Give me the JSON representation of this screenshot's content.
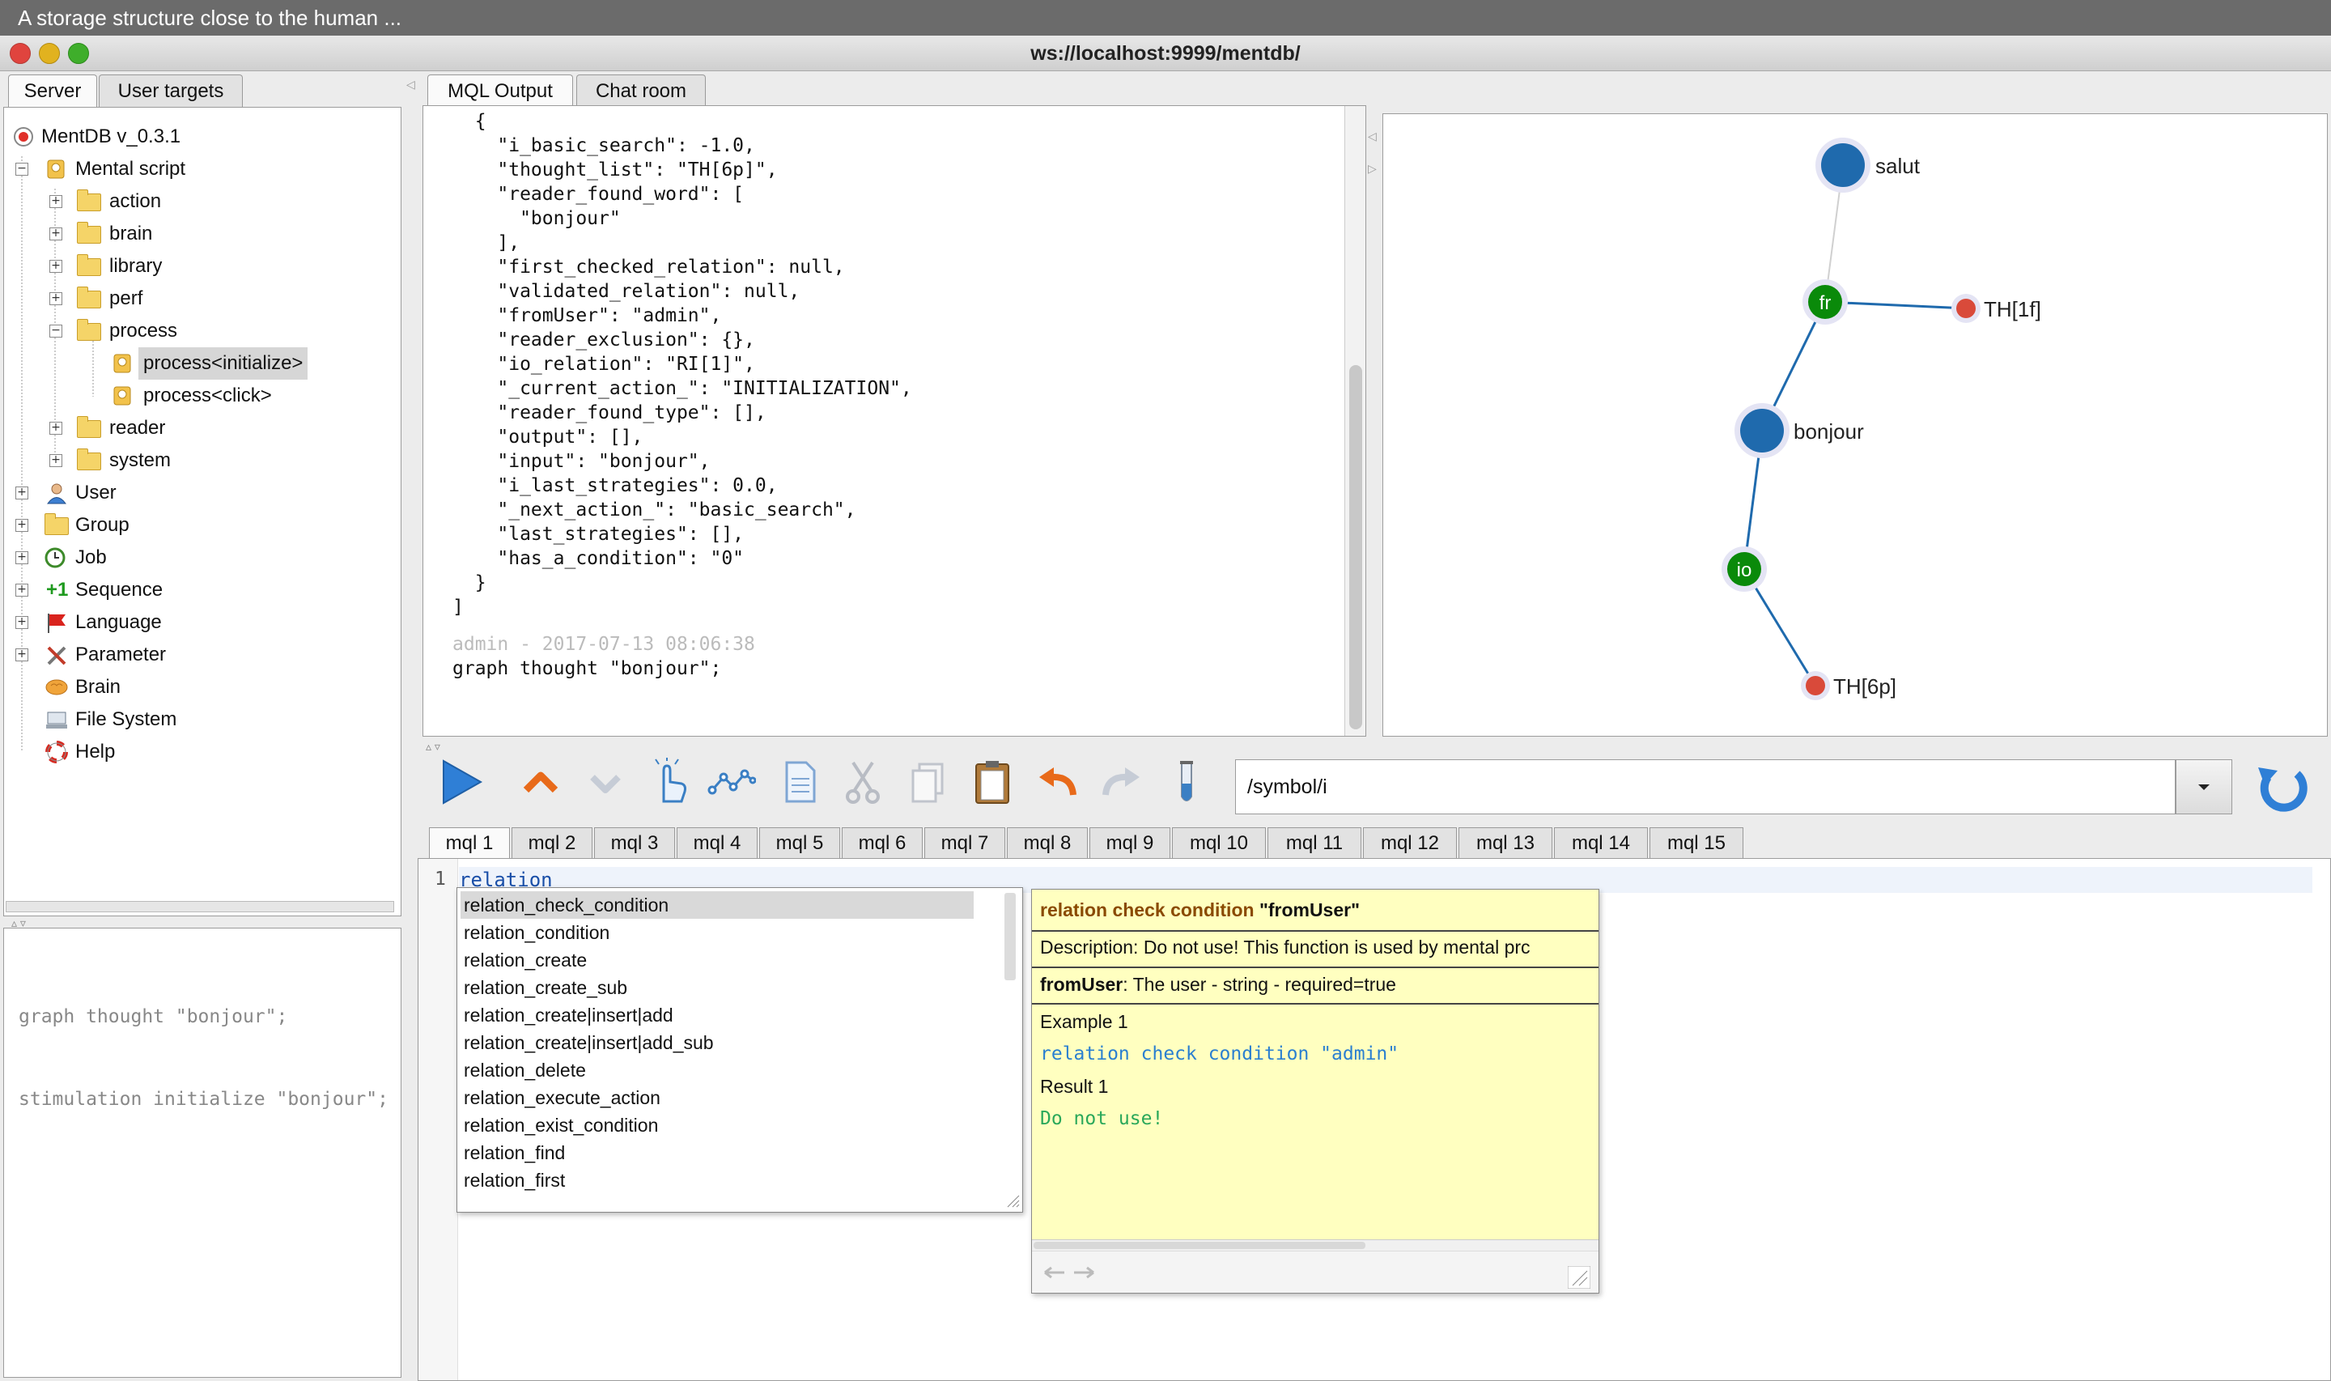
{
  "app": {
    "top_title": "A storage structure close to the human ...",
    "window_title": "ws://localhost:9999/mentdb/"
  },
  "left_tabs": [
    {
      "label": "Server",
      "active": true
    },
    {
      "label": "User targets",
      "active": false
    }
  ],
  "tree": {
    "root": "MentDB v_0.3.1",
    "mental_script": "Mental script",
    "folders": [
      "action",
      "brain",
      "library",
      "perf",
      "process"
    ],
    "process_children": [
      "process<initialize>",
      "process<click>"
    ],
    "folders2": [
      "reader",
      "system"
    ],
    "top_level": [
      "User",
      "Group",
      "Job",
      "Sequence",
      "Language",
      "Parameter",
      "Brain",
      "File System",
      "Help"
    ]
  },
  "script_box": {
    "lines": [
      "graph thought \"bonjour\";",
      "stimulation initialize \"bonjour\";"
    ]
  },
  "output_tabs": [
    {
      "label": "MQL Output",
      "active": true
    },
    {
      "label": "Chat room",
      "active": false
    }
  ],
  "output": {
    "json_lines": [
      "  {",
      "    \"i_basic_search\": -1.0,",
      "    \"thought_list\": \"TH[6p]\",",
      "    \"reader_found_word\": [",
      "      \"bonjour\"",
      "    ],",
      "    \"first_checked_relation\": null,",
      "    \"validated_relation\": null,",
      "    \"fromUser\": \"admin\",",
      "    \"reader_exclusion\": {},",
      "    \"io_relation\": \"RI[1]\",",
      "    \"_current_action_\": \"INITIALIZATION\",",
      "    \"reader_found_type\": [],",
      "    \"output\": [],",
      "    \"input\": \"bonjour\",",
      "    \"i_last_strategies\": 0.0,",
      "    \"_next_action_\": \"basic_search\",",
      "    \"last_strategies\": [],",
      "    \"has_a_condition\": \"0\"",
      "  }",
      "]"
    ],
    "meta": "admin - 2017-07-13 08:06:38",
    "command": "graph thought \"bonjour\";"
  },
  "graph": {
    "nodes": [
      {
        "id": "salut",
        "label": "salut"
      },
      {
        "id": "fr",
        "label": "fr"
      },
      {
        "id": "th1f",
        "label": "TH[1f]"
      },
      {
        "id": "bonjour",
        "label": "bonjour"
      },
      {
        "id": "io",
        "label": "io"
      },
      {
        "id": "th6p",
        "label": "TH[6p]"
      }
    ],
    "colors": {
      "blue": "#1f6aad",
      "green": "#0a8a0a",
      "red": "#d94a3a",
      "edge": "#1f6aad"
    }
  },
  "toolbar": {
    "icons": [
      "play-icon",
      "arrow-up-icon",
      "arrow-down-icon",
      "hand-pointer-icon",
      "graph-icon",
      "document-icon",
      "scissors-icon",
      "copy-icon",
      "paste-icon",
      "undo-icon",
      "redo-icon",
      "test-tube-icon"
    ],
    "path_value": "/symbol/i"
  },
  "mql_tabs": [
    "mql 1",
    "mql 2",
    "mql 3",
    "mql 4",
    "mql 5",
    "mql 6",
    "mql 7",
    "mql 8",
    "mql 9",
    "mql 10",
    "mql 11",
    "mql 12",
    "mql 13",
    "mql 14",
    "mql 15"
  ],
  "editor": {
    "line_number": "1",
    "text": "relation"
  },
  "autocomplete": {
    "items": [
      "relation_check_condition",
      "relation_condition",
      "relation_create",
      "relation_create_sub",
      "relation_create|insert|add",
      "relation_create|insert|add_sub",
      "relation_delete",
      "relation_execute_action",
      "relation_exist_condition",
      "relation_find",
      "relation_first"
    ],
    "selected_index": 0
  },
  "help": {
    "title_func": "relation check condition",
    "title_arg": "\"fromUser\"",
    "description": "Description: Do not use! This function is used by mental prc",
    "param_name": "fromUser",
    "param_desc": ": The user - string - required=true",
    "example_label": "Example 1",
    "example_code": "relation check condition \"admin\"",
    "result_label": "Result 1",
    "result_value": "Do not use!"
  }
}
